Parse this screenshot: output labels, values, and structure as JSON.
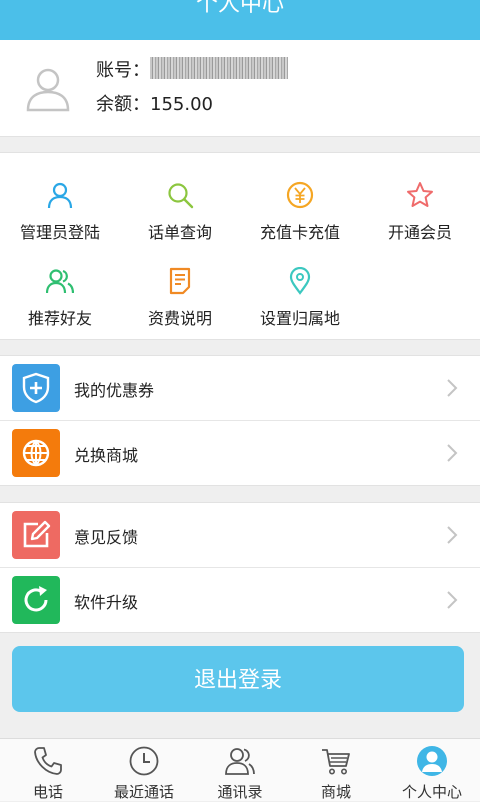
{
  "header": {
    "title": "个人中心"
  },
  "account": {
    "account_label": "账号：",
    "balance_label": "余额：",
    "balance_value": "155.00"
  },
  "grid": {
    "items": [
      {
        "label": "管理员登陆",
        "icon": "user-icon",
        "color": "#2aa7e6"
      },
      {
        "label": "话单查询",
        "icon": "search-icon",
        "color": "#8cc63f"
      },
      {
        "label": "充值卡充值",
        "icon": "yen-coin-icon",
        "color": "#f5a623"
      },
      {
        "label": "开通会员",
        "icon": "star-icon",
        "color": "#ef6b6b"
      },
      {
        "label": "推荐好友",
        "icon": "users-icon",
        "color": "#2fbf71"
      },
      {
        "label": "资费说明",
        "icon": "document-icon",
        "color": "#f08a24"
      },
      {
        "label": "设置归属地",
        "icon": "location-pin-icon",
        "color": "#3cc8c0"
      }
    ]
  },
  "menu": {
    "group1": [
      {
        "label": "我的优惠券",
        "icon": "shield-plus-icon",
        "color": "#3d9fe3"
      },
      {
        "label": "兑换商城",
        "icon": "globe-icon",
        "color": "#f47b0c"
      }
    ],
    "group2": [
      {
        "label": "意见反馈",
        "icon": "edit-icon",
        "color": "#ee6a62"
      },
      {
        "label": "软件升级",
        "icon": "refresh-icon",
        "color": "#21b85b"
      }
    ]
  },
  "logout": {
    "label": "退出登录"
  },
  "tabbar": {
    "tabs": [
      {
        "label": "电话",
        "icon": "phone-icon"
      },
      {
        "label": "最近通话",
        "icon": "clock-icon"
      },
      {
        "label": "通讯录",
        "icon": "contacts-icon"
      },
      {
        "label": "商城",
        "icon": "cart-icon"
      },
      {
        "label": "个人中心",
        "icon": "profile-icon",
        "active": true,
        "color": "#3fb6e6"
      }
    ]
  }
}
